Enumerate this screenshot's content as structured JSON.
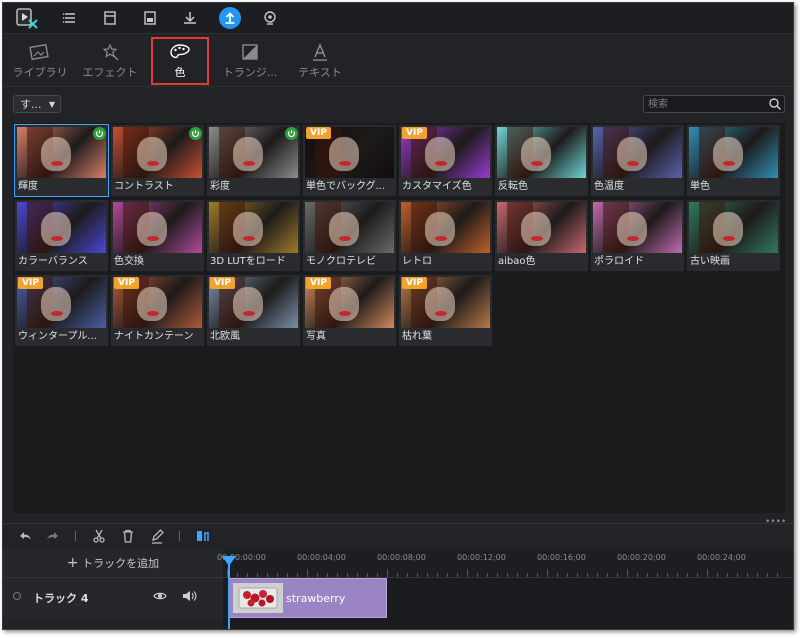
{
  "tabs": [
    {
      "label": "ライブラリ",
      "icon": "library-icon"
    },
    {
      "label": "エフェクト",
      "icon": "magic-wand-icon"
    },
    {
      "label": "色",
      "icon": "palette-icon"
    },
    {
      "label": "トランジ...",
      "icon": "transition-icon"
    },
    {
      "label": "テキスト",
      "icon": "text-icon"
    }
  ],
  "filter": {
    "selected": "す..."
  },
  "search": {
    "placeholder": "検索"
  },
  "effects": [
    {
      "name": "輝度",
      "badge": "free",
      "tint": "#d9806a"
    },
    {
      "name": "コントラスト",
      "badge": "free",
      "tint": "#c84f33"
    },
    {
      "name": "彩度",
      "badge": "free",
      "tint": "#8c8c8c"
    },
    {
      "name": "単色でバックグ...",
      "badge": "vip",
      "tint": "#120d0c"
    },
    {
      "name": "カスタマイズ色",
      "badge": "vip",
      "tint": "#9a3bd0"
    },
    {
      "name": "反転色",
      "badge": "",
      "tint": "#6fd6d4"
    },
    {
      "name": "色温度",
      "badge": "",
      "tint": "#5863b0"
    },
    {
      "name": "単色",
      "badge": "",
      "tint": "#2f8fb5"
    },
    {
      "name": "カラーバランス",
      "badge": "",
      "tint": "#4a47d6"
    },
    {
      "name": "色交換",
      "badge": "",
      "tint": "#b04a9a"
    },
    {
      "name": "3D LUTをロード",
      "badge": "",
      "tint": "#a07a2a"
    },
    {
      "name": "モノクロテレビ",
      "badge": "",
      "tint": "#6a6a6a"
    },
    {
      "name": "レトロ",
      "badge": "",
      "tint": "#c0602a"
    },
    {
      "name": "aibao色",
      "badge": "",
      "tint": "#c86870"
    },
    {
      "name": "ポラロイド",
      "badge": "",
      "tint": "#c06cae"
    },
    {
      "name": "古い映画",
      "badge": "",
      "tint": "#2f7a5e"
    },
    {
      "name": "ウィンタープル...",
      "badge": "vip",
      "tint": "#4a5fa6"
    },
    {
      "name": "ナイトカンテーン",
      "badge": "vip",
      "tint": "#b05a3a"
    },
    {
      "name": "北欧風",
      "badge": "vip",
      "tint": "#7890a8"
    },
    {
      "name": "写真",
      "badge": "vip",
      "tint": "#d08a5c"
    },
    {
      "name": "枯れ葉",
      "badge": "vip",
      "tint": "#b87a48"
    }
  ],
  "badges": {
    "vip": "VIP"
  },
  "timeline": {
    "add_track": "トラックを追加",
    "ticks": [
      "00:00:00:00",
      "00:00:04;00",
      "00:00:08;00",
      "00:00:12;00",
      "00:00:16;00",
      "00:00:20;00",
      "00:00:24;00"
    ],
    "track_name": "トラック 4",
    "clip_name": "strawberry"
  },
  "colors": {
    "accent": "#2196f3",
    "vip": "#f2a22e",
    "free": "#2e9e3b",
    "clip": "#9a84c4"
  }
}
